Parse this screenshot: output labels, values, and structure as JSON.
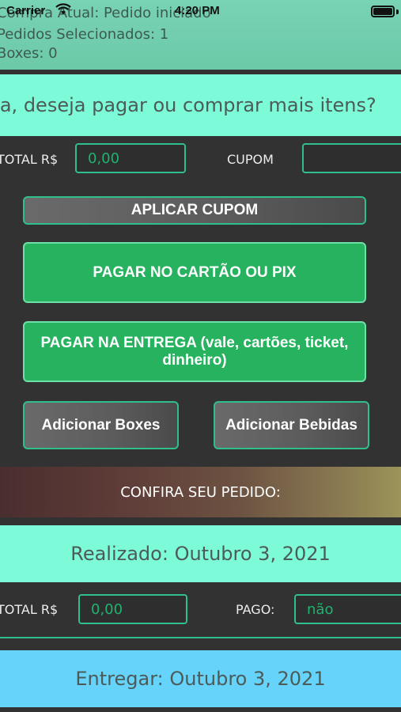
{
  "status_bar": {
    "carrier": "Carrier",
    "time": "4:20 PM",
    "wifi_icon": "wifi-icon",
    "battery_icon": "battery-icon"
  },
  "info": {
    "line1": "Compra Atual: Pedido iniciado",
    "line2": "Pedidos Selecionados: 1",
    "line3": "Boxes: 0"
  },
  "question": "Camilla, deseja pagar ou comprar mais itens?",
  "order": {
    "total_label": "TOTAL R$",
    "total_value": "0,00",
    "coupon_label": "CUPOM",
    "coupon_value": ""
  },
  "buttons": {
    "apply_coupon": "APLICAR CUPOM",
    "pay_card_pix": "PAGAR NO CARTÃO OU PIX",
    "pay_on_delivery": "PAGAR NA ENTREGA (vale, cartões, ticket, dinheiro)",
    "add_boxes": "Adicionar Boxes",
    "add_drinks": "Adicionar Bebidas"
  },
  "review": {
    "title": "CONFIRA SEU PEDIDO:",
    "realizado": "Realizado: Outubro 3, 2021",
    "total_label": "TOTAL R$",
    "total_value": "0,00",
    "paid_label": "PAGO:",
    "paid_value": "não",
    "entregar": "Entregar: Outubro 3, 2021"
  },
  "colors": {
    "accent_mint": "#7dfbd9",
    "green_button": "#26b25f",
    "blue_band": "#66d3fb",
    "background": "#323232"
  }
}
